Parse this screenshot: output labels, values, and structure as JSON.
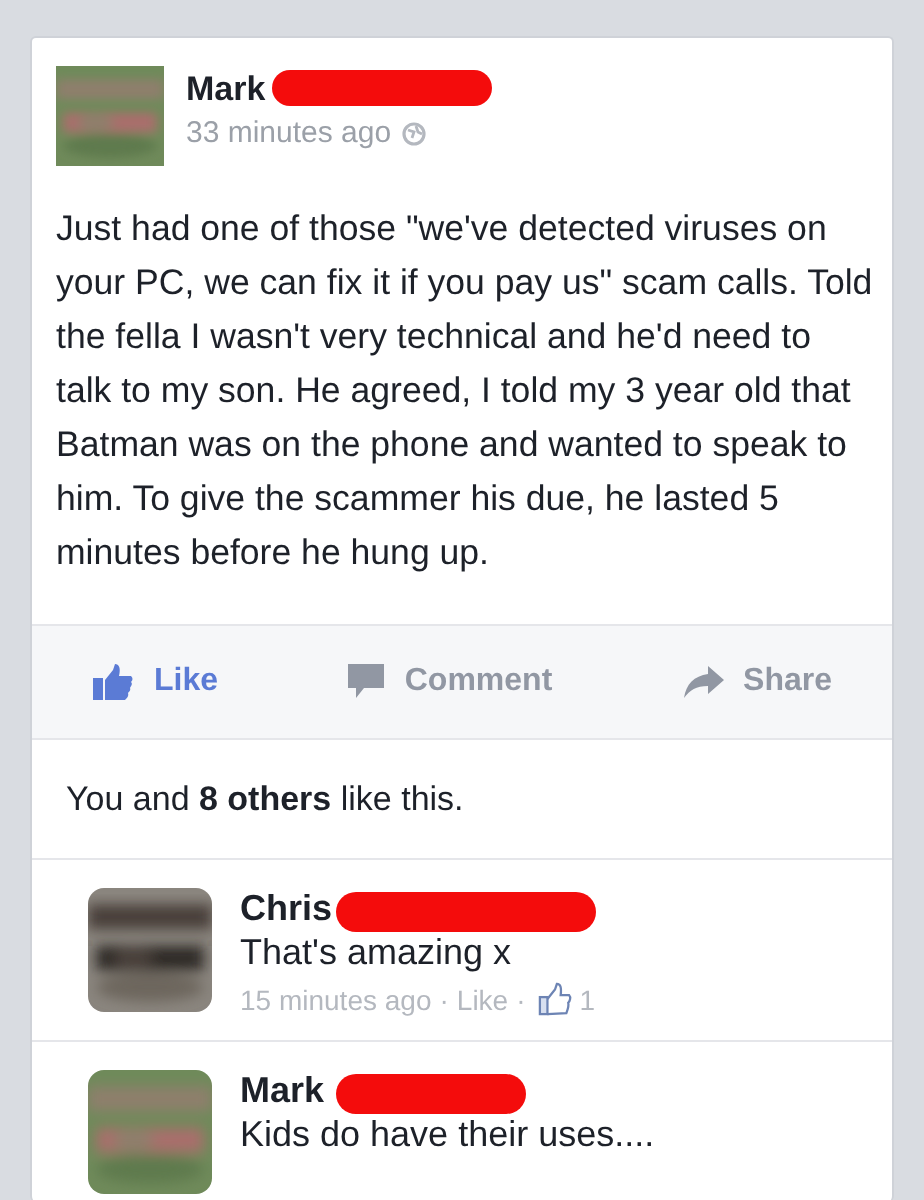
{
  "post": {
    "author": "Mark",
    "time": "33 minutes ago",
    "text": "Just had one of those \"we've detected viruses on your PC, we can fix it if you pay us\" scam calls. Told the fella I wasn't very technical and he'd need to talk to my son. He agreed, I told my 3 year old that Batman was on the phone and wanted to speak to him. To give the scammer his due, he lasted 5 minutes before he hung up.",
    "actions": [
      {
        "kind": "like",
        "label": "Like",
        "active": true
      },
      {
        "kind": "comment",
        "label": "Comment",
        "active": false
      },
      {
        "kind": "share",
        "label": "Share",
        "active": false
      }
    ],
    "likes_summary": "You and **8 others** like this.",
    "comments": [
      {
        "author": "Chris",
        "text": "That's amazing x",
        "meta": [
          {
            "kind": "time",
            "text": "15 minutes ago"
          },
          {
            "kind": "sep",
            "text": "·"
          },
          {
            "kind": "like",
            "text": "Like"
          },
          {
            "kind": "sep",
            "text": "·"
          },
          {
            "kind": "count",
            "text": "1"
          }
        ]
      },
      {
        "author": "Mark",
        "text": "Kids do have their uses...."
      }
    ]
  }
}
